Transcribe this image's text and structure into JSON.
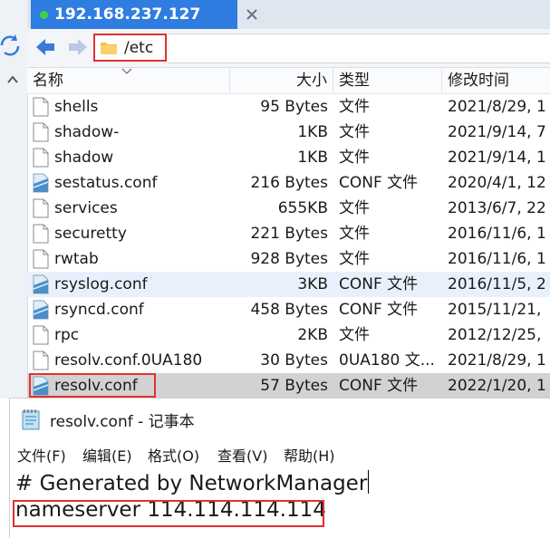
{
  "window": {
    "tab_title": "192.168.237.127"
  },
  "toolbar": {
    "path": "/etc"
  },
  "columns": {
    "name": "名称",
    "size": "大小",
    "type": "类型",
    "modified": "修改时间"
  },
  "files": [
    {
      "name": "shells",
      "size": "95 Bytes",
      "type": "文件",
      "modified": "2021/8/29, 1",
      "icon": "blank-file-icon"
    },
    {
      "name": "shadow-",
      "size": "1KB",
      "type": "文件",
      "modified": "2021/9/14, 7",
      "icon": "blank-file-icon"
    },
    {
      "name": "shadow",
      "size": "1KB",
      "type": "文件",
      "modified": "2021/9/14, 1",
      "icon": "blank-file-icon"
    },
    {
      "name": "sestatus.conf",
      "size": "216 Bytes",
      "type": "CONF 文件",
      "modified": "2020/4/1, 12",
      "icon": "conf-file-icon"
    },
    {
      "name": "services",
      "size": "655KB",
      "type": "文件",
      "modified": "2013/6/7, 22",
      "icon": "blank-file-icon"
    },
    {
      "name": "securetty",
      "size": "221 Bytes",
      "type": "文件",
      "modified": "2016/11/6, 1",
      "icon": "blank-file-icon"
    },
    {
      "name": "rwtab",
      "size": "928 Bytes",
      "type": "文件",
      "modified": "2016/11/6, 1",
      "icon": "blank-file-icon"
    },
    {
      "name": "rsyslog.conf",
      "size": "3KB",
      "type": "CONF 文件",
      "modified": "2016/11/5, 2",
      "icon": "conf-file-icon"
    },
    {
      "name": "rsyncd.conf",
      "size": "458 Bytes",
      "type": "CONF 文件",
      "modified": "2015/11/21,",
      "icon": "conf-file-icon"
    },
    {
      "name": "rpc",
      "size": "2KB",
      "type": "文件",
      "modified": "2012/12/25,",
      "icon": "blank-file-icon"
    },
    {
      "name": "resolv.conf.0UA180",
      "size": "30 Bytes",
      "type": "0UA180 文...",
      "modified": "2021/8/29, 1",
      "icon": "blank-file-icon"
    },
    {
      "name": "resolv.conf",
      "size": "57 Bytes",
      "type": "CONF 文件",
      "modified": "2022/1/20, 1",
      "icon": "conf-file-icon"
    }
  ],
  "notepad": {
    "title": "resolv.conf - 记事本",
    "menu": [
      "文件(F)",
      "编辑(E)",
      "格式(O)",
      "查看(V)",
      "帮助(H)"
    ],
    "lines": [
      "# Generated by NetworkManager",
      "nameserver 114.114.114.114"
    ]
  },
  "colors": {
    "tab_active": "#2f7de1",
    "status_dot": "#3fd14a",
    "highlight_box": "#e03131",
    "selected_row": "#d2d2d2",
    "hover_row": "#e8f1fb"
  }
}
